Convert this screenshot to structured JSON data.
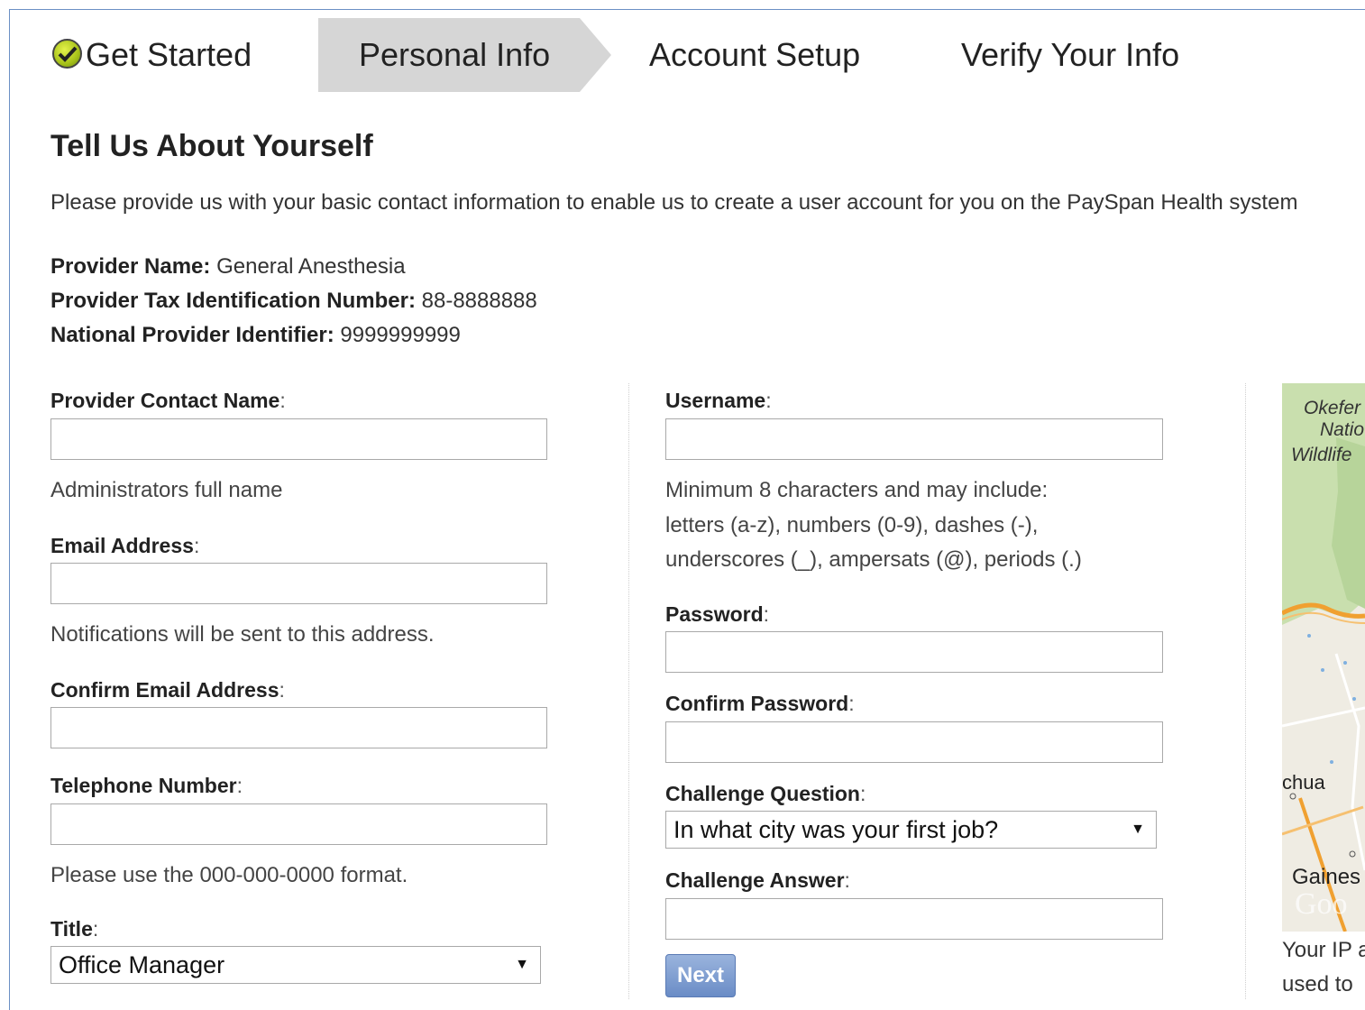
{
  "steps": [
    {
      "label": "Get Started",
      "state": "completed"
    },
    {
      "label": "Personal Info",
      "state": "active"
    },
    {
      "label": "Account Setup",
      "state": "upcoming"
    },
    {
      "label": "Verify Your Info",
      "state": "upcoming"
    }
  ],
  "page": {
    "title": "Tell Us About Yourself",
    "intro": "Please provide us with your basic contact information to enable us to create a user account for you on the PaySpan Health system"
  },
  "provider": {
    "name_label": "Provider Name:",
    "name_value": "General Anesthesia",
    "tin_label": "Provider Tax Identification Number:",
    "tin_value": "88-8888888",
    "npi_label": "National Provider Identifier:",
    "npi_value": "9999999999"
  },
  "form_left": {
    "contact_name_label": "Provider Contact Name",
    "contact_name_value": "",
    "contact_name_help": "Administrators full name",
    "email_label": "Email Address",
    "email_value": "",
    "email_help": "Notifications will be sent to this address.",
    "confirm_email_label": "Confirm Email Address",
    "confirm_email_value": "",
    "phone_label": "Telephone Number",
    "phone_value": "",
    "phone_help": "Please use the 000-000-0000 format.",
    "title_label": "Title",
    "title_selected": "Office Manager"
  },
  "form_right": {
    "username_label": "Username",
    "username_value": "",
    "username_help_1": "Minimum 8 characters and may include:",
    "username_help_2": "letters (a-z), numbers (0-9), dashes (-),",
    "username_help_3": "underscores (_), ampersats (@), periods (.)",
    "password_label": "Password",
    "password_value": "",
    "confirm_password_label": "Confirm Password",
    "confirm_password_value": "",
    "challenge_q_label": "Challenge Question",
    "challenge_q_selected": "In what city was your first job?",
    "challenge_a_label": "Challenge Answer",
    "challenge_a_value": "",
    "next_label": "Next"
  },
  "map": {
    "labels": [
      "Okefer",
      "Natio",
      "Wildlife",
      "chua",
      "Gaines",
      "Goo"
    ],
    "caption_1": "Your IP a",
    "caption_2": "used to"
  },
  "colors": {
    "active_step_bg": "#d6d6d6",
    "next_button": "#7a9bd0",
    "frame_border": "#6b8fc4"
  }
}
